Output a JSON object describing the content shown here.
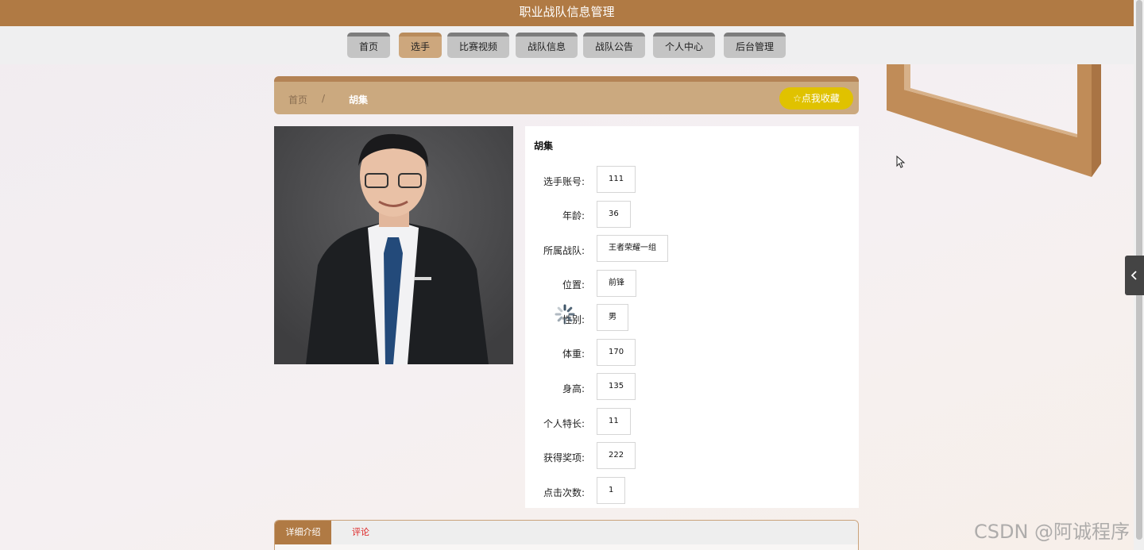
{
  "app": {
    "title": "职业战队信息管理"
  },
  "nav": {
    "items": [
      {
        "label": "首页"
      },
      {
        "label": "选手"
      },
      {
        "label": "比赛视频"
      },
      {
        "label": "战队信息"
      },
      {
        "label": "战队公告"
      },
      {
        "label": "个人中心"
      },
      {
        "label": "后台管理"
      }
    ],
    "active_index": 1
  },
  "breadcrumb": {
    "home": "首页",
    "separator": "/",
    "current": "胡集"
  },
  "favorite_button": {
    "icon": "star-outline-icon",
    "label": "☆点我收藏"
  },
  "player": {
    "name": "胡集",
    "fields": [
      {
        "label": "选手账号:",
        "value": "111"
      },
      {
        "label": "年龄:",
        "value": "36"
      },
      {
        "label": "所属战队:",
        "value": "王者荣耀一组"
      },
      {
        "label": "位置:",
        "value": "前锋"
      },
      {
        "label": "性别:",
        "value": "男"
      },
      {
        "label": "体重:",
        "value": "170"
      },
      {
        "label": "身高:",
        "value": "135"
      },
      {
        "label": "个人特长:",
        "value": "11"
      },
      {
        "label": "获得奖项:",
        "value": "222"
      },
      {
        "label": "点击次数:",
        "value": "1"
      }
    ]
  },
  "tabs": [
    {
      "label": "详细介绍"
    },
    {
      "label": "评论"
    }
  ],
  "watermark": "CSDN @阿诚程序",
  "colors": {
    "brand": "#b07a44",
    "nav_active": "#cda77d",
    "breadcrumb_bg": "#cba97f",
    "favorite": "#e0c200",
    "comment_tab": "#dd2222"
  }
}
